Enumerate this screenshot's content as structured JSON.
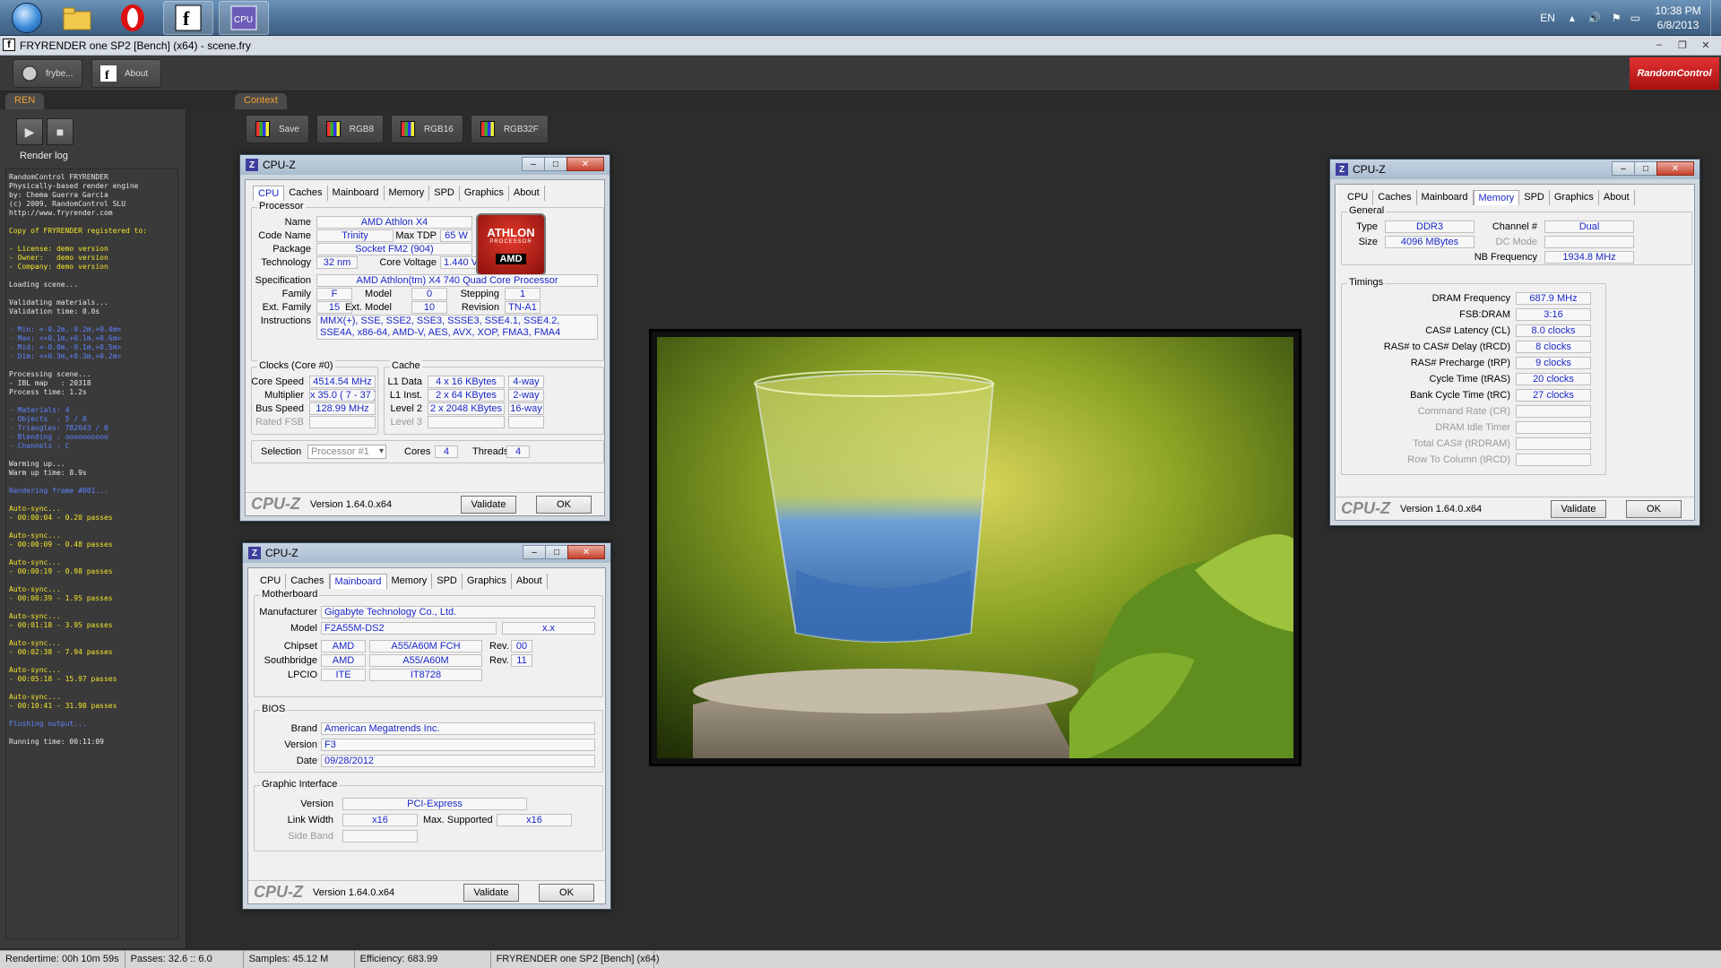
{
  "taskbar": {
    "language": "EN",
    "time": "10:38 PM",
    "date": "6/8/2013",
    "apps": [
      "start-menu",
      "explorer",
      "opera",
      "fryrender",
      "cpuz"
    ]
  },
  "app": {
    "title": "FRYRENDER one SP2 [Bench] (x64) - scene.fry",
    "toolbar": {
      "fryrender_label": "frybe...",
      "about_label": "About"
    },
    "brand": "RandomControl",
    "left_tab": "REN",
    "context_tab": "Context",
    "render_log_title": "Render log",
    "context_buttons": [
      "Save",
      "RGB8",
      "RGB16",
      "RGB32F"
    ]
  },
  "log": [
    {
      "c": "w",
      "t": "RandomControl FRYRENDER"
    },
    {
      "c": "w",
      "t": "Physically-based render engine"
    },
    {
      "c": "w",
      "t": "by: Chema Guerra Garcia"
    },
    {
      "c": "w",
      "t": "(c) 2009, RandomControl SLU"
    },
    {
      "c": "w",
      "t": "http://www.fryrender.com"
    },
    {
      "c": "w",
      "t": ""
    },
    {
      "c": "y",
      "t": "Copy of FRYRENDER registered to:"
    },
    {
      "c": "w",
      "t": ""
    },
    {
      "c": "y",
      "t": "- License: demo version"
    },
    {
      "c": "y",
      "t": "- Owner:   demo version"
    },
    {
      "c": "y",
      "t": "- Company: demo version"
    },
    {
      "c": "w",
      "t": ""
    },
    {
      "c": "w",
      "t": "Loading scene..."
    },
    {
      "c": "w",
      "t": ""
    },
    {
      "c": "w",
      "t": "Validating materials..."
    },
    {
      "c": "w",
      "t": "Validation time: 0.0s"
    },
    {
      "c": "w",
      "t": ""
    },
    {
      "c": "b",
      "t": "- Min: <-0.2m,-0.2m,+0.4m>"
    },
    {
      "c": "b",
      "t": "- Max: <+0.1m,+0.1m,+0.6m>"
    },
    {
      "c": "b",
      "t": "- Mid: <-0.0m,-0.1m,+0.5m>"
    },
    {
      "c": "b",
      "t": "- Dim: <+0.3m,+0.3m,+0.2m>"
    },
    {
      "c": "w",
      "t": ""
    },
    {
      "c": "w",
      "t": "Processing scene..."
    },
    {
      "c": "w",
      "t": "- IBL map   : 20318"
    },
    {
      "c": "w",
      "t": "Process time: 1.2s"
    },
    {
      "c": "w",
      "t": ""
    },
    {
      "c": "b",
      "t": "- Materials: 4"
    },
    {
      "c": "b",
      "t": "- Objects  : 5 / 0"
    },
    {
      "c": "b",
      "t": "- Triangles: 782643 / 0"
    },
    {
      "c": "b",
      "t": "- Blending : oooooooooo"
    },
    {
      "c": "b",
      "t": "- Channels : C"
    },
    {
      "c": "w",
      "t": ""
    },
    {
      "c": "w",
      "t": "Warming up..."
    },
    {
      "c": "w",
      "t": "Warm up time: 8.9s"
    },
    {
      "c": "w",
      "t": ""
    },
    {
      "c": "b",
      "t": "Rendering frame #001..."
    },
    {
      "c": "w",
      "t": ""
    },
    {
      "c": "y",
      "t": "Auto-sync..."
    },
    {
      "c": "y",
      "t": "- 00:00:04 - 0.20 passes"
    },
    {
      "c": "w",
      "t": ""
    },
    {
      "c": "y",
      "t": "Auto-sync..."
    },
    {
      "c": "y",
      "t": "- 00:00:09 - 0.48 passes"
    },
    {
      "c": "w",
      "t": ""
    },
    {
      "c": "y",
      "t": "Auto-sync..."
    },
    {
      "c": "y",
      "t": "- 00:00:19 - 0.98 passes"
    },
    {
      "c": "w",
      "t": ""
    },
    {
      "c": "y",
      "t": "Auto-sync..."
    },
    {
      "c": "y",
      "t": "- 00:00:39 - 1.95 passes"
    },
    {
      "c": "w",
      "t": ""
    },
    {
      "c": "y",
      "t": "Auto-sync..."
    },
    {
      "c": "y",
      "t": "- 00:01:18 - 3.95 passes"
    },
    {
      "c": "w",
      "t": ""
    },
    {
      "c": "y",
      "t": "Auto-sync..."
    },
    {
      "c": "y",
      "t": "- 00:02:38 - 7.94 passes"
    },
    {
      "c": "w",
      "t": ""
    },
    {
      "c": "y",
      "t": "Auto-sync..."
    },
    {
      "c": "y",
      "t": "- 00:05:18 - 15.97 passes"
    },
    {
      "c": "w",
      "t": ""
    },
    {
      "c": "y",
      "t": "Auto-sync..."
    },
    {
      "c": "y",
      "t": "- 00:10:41 - 31.98 passes"
    },
    {
      "c": "w",
      "t": ""
    },
    {
      "c": "b",
      "t": "Flushing output..."
    },
    {
      "c": "w",
      "t": ""
    },
    {
      "c": "w",
      "t": "Running time: 00:11:09"
    }
  ],
  "status": {
    "rendertime": "Rendertime: 00h 10m 59s",
    "passes": "Passes: 32.6 :: 6.0",
    "samples": "Samples: 45.12 M",
    "efficiency": "Efficiency: 683.99",
    "product": "FRYRENDER one SP2 [Bench] (x64)"
  },
  "cpuz_common": {
    "title": "CPU-Z",
    "tabs": [
      "CPU",
      "Caches",
      "Mainboard",
      "Memory",
      "SPD",
      "Graphics",
      "About"
    ],
    "logo": "CPU-Z",
    "version": "Version 1.64.0.x64",
    "validate": "Validate",
    "ok": "OK"
  },
  "cpu": {
    "processor_group": "Processor",
    "name_label": "Name",
    "name": "AMD Athlon X4",
    "codename_label": "Code Name",
    "codename": "Trinity",
    "maxtdp_label": "Max TDP",
    "maxtdp": "65 W",
    "package_label": "Package",
    "package": "Socket FM2 (904)",
    "technology_label": "Technology",
    "technology": "32 nm",
    "corevoltage_label": "Core Voltage",
    "corevoltage": "1.440 V",
    "spec_label": "Specification",
    "spec": "AMD Athlon(tm) X4 740 Quad Core Processor",
    "family_label": "Family",
    "family": "F",
    "model_label": "Model",
    "model": "0",
    "stepping_label": "Stepping",
    "stepping": "1",
    "extfamily_label": "Ext. Family",
    "extfamily": "15",
    "extmodel_label": "Ext. Model",
    "extmodel": "10",
    "revision_label": "Revision",
    "revision": "TN-A1",
    "instructions_label": "Instructions",
    "instructions": "MMX(+), SSE, SSE2, SSE3, SSSE3, SSE4.1, SSE4.2, SSE4A, x86-64, AMD-V, AES, AVX, XOP, FMA3, FMA4",
    "logo_top": "ATHLON",
    "logo_sub": "PROCESSOR",
    "logo_brand": "AMD",
    "clocks_group": "Clocks (Core #0)",
    "corespeed_label": "Core Speed",
    "corespeed": "4514.54 MHz",
    "multiplier_label": "Multiplier",
    "multiplier": "x 35.0 ( 7 - 37 )",
    "busspeed_label": "Bus Speed",
    "busspeed": "128.99 MHz",
    "ratedfsb_label": "Rated FSB",
    "cache_group": "Cache",
    "l1data_label": "L1 Data",
    "l1data": "4 x 16 KBytes",
    "l1data_way": "4-way",
    "l1inst_label": "L1 Inst.",
    "l1inst": "2 x 64 KBytes",
    "l1inst_way": "2-way",
    "level2_label": "Level 2",
    "level2": "2 x 2048 KBytes",
    "level2_way": "16-way",
    "level3_label": "Level 3",
    "selection_label": "Selection",
    "selection": "Processor #1",
    "cores_label": "Cores",
    "cores": "4",
    "threads_label": "Threads",
    "threads": "4"
  },
  "mainboard": {
    "motherboard_group": "Motherboard",
    "manufacturer_label": "Manufacturer",
    "manufacturer": "Gigabyte Technology Co., Ltd.",
    "model_label": "Model",
    "model": "F2A55M-DS2",
    "model_rev": "x.x",
    "chipset_label": "Chipset",
    "chipset_vendor": "AMD",
    "chipset_model": "A55/A60M FCH",
    "chipset_rev_label": "Rev.",
    "chipset_rev": "00",
    "southbridge_label": "Southbridge",
    "sb_vendor": "AMD",
    "sb_model": "A55/A60M",
    "sb_rev_label": "Rev.",
    "sb_rev": "11",
    "lpcio_label": "LPCIO",
    "lpcio_vendor": "ITE",
    "lpcio_model": "IT8728",
    "bios_group": "BIOS",
    "brand_label": "Brand",
    "brand": "American Megatrends Inc.",
    "version_label": "Version",
    "version": "F3",
    "date_label": "Date",
    "date": "09/28/2012",
    "graphic_group": "Graphic Interface",
    "gi_version_label": "Version",
    "gi_version": "PCI-Express",
    "linkwidth_label": "Link Width",
    "linkwidth": "x16",
    "maxsupported_label": "Max. Supported",
    "maxsupported": "x16",
    "sideband_label": "Side Band"
  },
  "memory": {
    "general_group": "General",
    "type_label": "Type",
    "type": "DDR3",
    "size_label": "Size",
    "size": "4096 MBytes",
    "channel_label": "Channel #",
    "channel": "Dual",
    "dcmode_label": "DC Mode",
    "nbfreq_label": "NB Frequency",
    "nbfreq": "1934.8 MHz",
    "timings_group": "Timings",
    "dramfreq_label": "DRAM Frequency",
    "dramfreq": "687.9 MHz",
    "fsbdram_label": "FSB:DRAM",
    "fsbdram": "3:16",
    "cas_label": "CAS# Latency (CL)",
    "cas": "8.0 clocks",
    "trcd_label": "RAS# to CAS# Delay (tRCD)",
    "trcd": "8 clocks",
    "trp_label": "RAS# Precharge (tRP)",
    "trp": "9 clocks",
    "tras_label": "Cycle Time (tRAS)",
    "tras": "20 clocks",
    "trc_label": "Bank Cycle Time (tRC)",
    "trc": "27 clocks",
    "cr_label": "Command Rate (CR)",
    "idle_label": "DRAM Idle Timer",
    "trdram_label": "Total CAS# (tRDRAM)",
    "trcd2_label": "Row To Column (tRCD)"
  }
}
